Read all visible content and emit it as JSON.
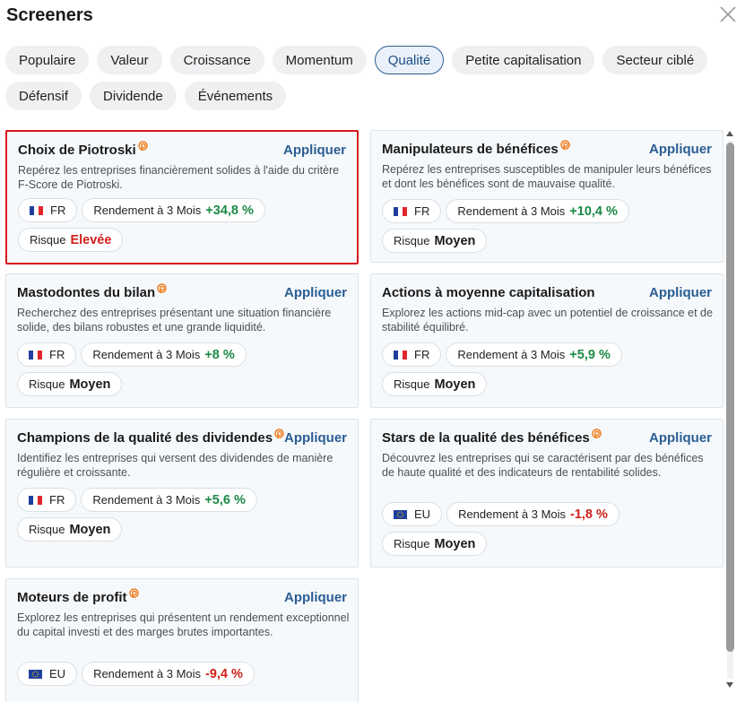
{
  "header": {
    "title": "Screeners",
    "close_icon": "close-icon"
  },
  "tabs": [
    {
      "label": "Populaire",
      "active": false
    },
    {
      "label": "Valeur",
      "active": false
    },
    {
      "label": "Croissance",
      "active": false
    },
    {
      "label": "Momentum",
      "active": false
    },
    {
      "label": "Qualité",
      "active": true
    },
    {
      "label": "Petite capitalisation",
      "active": false
    },
    {
      "label": "Secteur ciblé",
      "active": false
    },
    {
      "label": "Défensif",
      "active": false
    },
    {
      "label": "Dividende",
      "active": false
    },
    {
      "label": "Événements",
      "active": false
    }
  ],
  "apply_label": "Appliquer",
  "return_label": "Rendement à 3 Mois",
  "risk_label": "Risque",
  "colors": {
    "accent": "#2a5d93",
    "positive": "#1a8a44",
    "negative": "#d0201a",
    "selected_border": "#d8161b",
    "pro_badge": "#f07c1a"
  },
  "cards": [
    {
      "title": "Choix de Piotroski",
      "desc": "Repérez les entreprises financièrement solides à l'aide du critère F-Score de Piotroski.",
      "region": "FR",
      "flag": "fr-flag",
      "return": "+34,8 %",
      "risk": "Elevée"
    },
    {
      "title": "Manipulateurs de bénéfices",
      "desc": "Repérez les entreprises susceptibles de manipuler leurs bénéfices et dont les bénéfices sont de mauvaise qualité.",
      "region": "FR",
      "flag": "fr-flag",
      "return": "+10,4 %",
      "risk": "Moyen"
    },
    {
      "title": "Mastodontes du bilan",
      "desc": "Recherchez des entreprises présentant une situation financière solide, des bilans robustes et une grande liquidité.",
      "region": "FR",
      "flag": "fr-flag",
      "return": "+8 %",
      "risk": "Moyen"
    },
    {
      "title": "Actions à moyenne capitalisation",
      "desc": "Explorez les actions mid-cap avec un potentiel de croissance et de stabilité équilibré.",
      "region": "FR",
      "flag": "fr-flag",
      "return": "+5,9 %",
      "risk": "Moyen"
    },
    {
      "title": "Champions de la qualité des dividendes",
      "desc": "Identifiez les entreprises qui versent des dividendes de manière régulière et croissante.",
      "region": "FR",
      "flag": "fr-flag",
      "return": "+5,6 %",
      "risk": "Moyen"
    },
    {
      "title": "Stars de la qualité des bénéfices",
      "desc": "Découvrez les entreprises qui se caractérisent par des bénéfices de haute qualité et des indicateurs de rentabilité solides.",
      "region": "EU",
      "flag": "eu-flag",
      "return": "-1,8 %",
      "risk": "Moyen"
    },
    {
      "title": "Moteurs de profit",
      "desc": "Explorez les entreprises qui présentent un rendement exceptionnel du capital investi et des marges brutes importantes.",
      "region": "EU",
      "flag": "eu-flag",
      "return": "-9,4 %",
      "risk": ""
    }
  ]
}
